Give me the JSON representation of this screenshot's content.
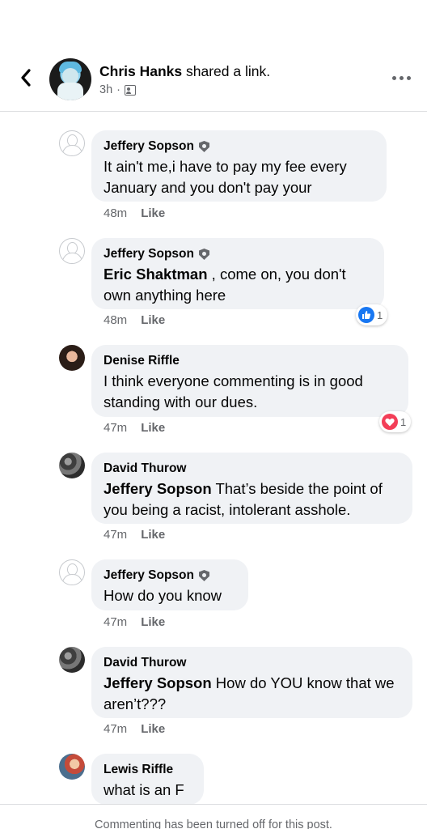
{
  "header": {
    "author": "Chris Hanks",
    "action": " shared a link.",
    "time": "3h",
    "separator": "·"
  },
  "comments": [
    {
      "name": "Jeffery Sopson",
      "badge": true,
      "mention": "",
      "text": "It ain't me,i have to pay my fee every January and you don't pay your",
      "time": "48m",
      "like": "Like"
    },
    {
      "name": "Jeffery Sopson",
      "badge": true,
      "mention": "Eric Shaktman",
      "text": " , come on, you don't own anything here",
      "time": "48m",
      "like": "Like",
      "reaction": {
        "type": "like",
        "count": "1"
      }
    },
    {
      "name": "Denise Riffle",
      "badge": false,
      "mention": "",
      "text": "I think everyone commenting is in good standing with our dues.",
      "time": "47m",
      "like": "Like",
      "reaction": {
        "type": "love",
        "count": "1"
      }
    },
    {
      "name": "David Thurow",
      "badge": false,
      "mention": "Jeffery Sopson",
      "text": " That’s beside the point of you being a racist, intolerant asshole.",
      "time": "47m",
      "like": "Like"
    },
    {
      "name": "Jeffery Sopson",
      "badge": true,
      "mention": "",
      "text": "How do you know",
      "time": "47m",
      "like": "Like"
    },
    {
      "name": "David Thurow",
      "badge": false,
      "mention": "Jeffery Sopson",
      "text": " How do YOU know that we aren’t???",
      "time": "47m",
      "like": "Like"
    },
    {
      "name": "Lewis Riffle",
      "badge": false,
      "mention": "",
      "text": "what is an F",
      "time": "",
      "like": ""
    }
  ],
  "footer": {
    "notice": "Commenting has been turned off for this post."
  },
  "colors": {
    "like_blue": "#1877f2",
    "love_red": "#f33e58",
    "bubble_gray": "#f0f2f5"
  },
  "icons": [
    "back-arrow-icon",
    "audience-icon",
    "more-options-icon",
    "verified-badge-icon",
    "like-reaction-icon",
    "love-reaction-icon"
  ]
}
